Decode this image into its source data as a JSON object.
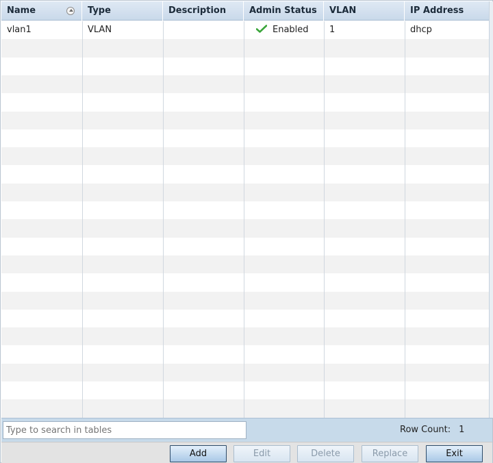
{
  "table": {
    "columns": [
      {
        "key": "name",
        "label": "Name",
        "sortable": true
      },
      {
        "key": "type",
        "label": "Type"
      },
      {
        "key": "description",
        "label": "Description"
      },
      {
        "key": "admin_status",
        "label": "Admin Status"
      },
      {
        "key": "vlan",
        "label": "VLAN"
      },
      {
        "key": "ip_address",
        "label": "IP Address"
      }
    ],
    "rows": [
      {
        "name": "vlan1",
        "type": "VLAN",
        "description": "",
        "admin_status": "Enabled",
        "admin_status_icon": "check-icon",
        "vlan": "1",
        "ip_address": "dhcp"
      }
    ]
  },
  "search": {
    "placeholder": "Type to search in tables",
    "value": ""
  },
  "row_count": {
    "label": "Row Count:",
    "value": "1"
  },
  "buttons": {
    "add": "Add",
    "edit": "Edit",
    "delete": "Delete",
    "replace": "Replace",
    "exit": "Exit"
  },
  "colors": {
    "header_bg": "#c9d9ea",
    "alt_row_bg": "#f2f2f2",
    "check_green": "#3aa53a",
    "footer_bg": "#c7daea"
  }
}
